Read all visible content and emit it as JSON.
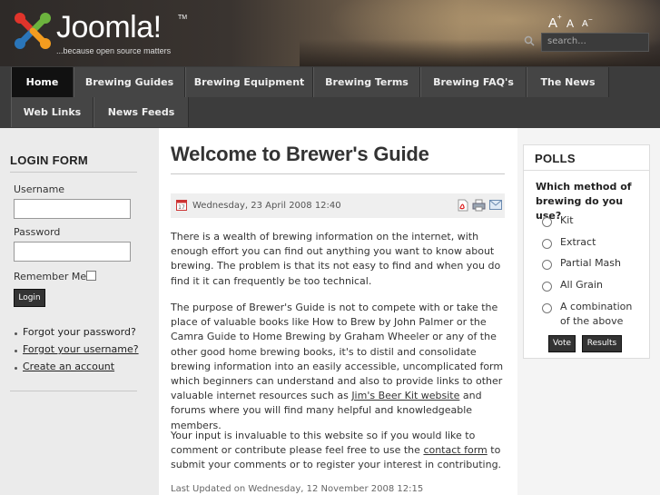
{
  "header": {
    "logo_text": "Joomla!",
    "logo_tm": "TM",
    "tagline": "...because open source matters",
    "font_size_controls": [
      "A",
      "A",
      "A"
    ],
    "search_placeholder": "search...",
    "colors": {
      "logo_red": "#e0342b",
      "logo_green": "#6cb33e",
      "logo_blue": "#2a75b9",
      "logo_orange": "#f39c1f"
    }
  },
  "nav": {
    "items": [
      {
        "label": "Home",
        "active": true
      },
      {
        "label": "Brewing Guides",
        "active": false
      },
      {
        "label": "Brewing Equipment",
        "active": false
      },
      {
        "label": "Brewing Terms",
        "active": false
      },
      {
        "label": "Brewing FAQ's",
        "active": false
      },
      {
        "label": "The News",
        "active": false
      },
      {
        "label": "Web Links",
        "active": false
      },
      {
        "label": "News Feeds",
        "active": false
      }
    ]
  },
  "login": {
    "title": "LOGIN FORM",
    "username_label": "Username",
    "password_label": "Password",
    "remember_label": "Remember Me",
    "submit_label": "Login",
    "links": [
      "Forgot your password?",
      "Forgot your username?",
      "Create an account"
    ]
  },
  "article": {
    "title": "Welcome to Brewer's Guide",
    "date": "Wednesday, 23 April 2008 12:40",
    "icons": [
      "calendar-icon",
      "pdf-icon",
      "print-icon",
      "email-icon"
    ],
    "p1": "There is a wealth of brewing information on the internet, with enough effort you can find out anything you want to know about brewing. The problem is that its not easy to find and when you do find it it can frequently be too technical.",
    "p2_before": "The purpose of Brewer's Guide is not to compete with or take the place of valuable books like How to Brew by John Palmer or the Camra Guide to Home Brewing by Graham Wheeler or any of the other good home brewing books, it's to distil and consolidate brewing information into an easily accessible, uncomplicated form which beginners can understand and also to provide links to other valuable internet resources such as",
    "p2_link": "Jim's Beer Kit website",
    "p2_after": "and forums where you will find many helpful and knowledgeable members.",
    "p3_before": "Your input is invaluable to this website so if you would like to comment or contribute please feel free to use the",
    "p3_link": "contact form",
    "p3_after": "to submit your comments or to register your interest in contributing.",
    "updated": "Last Updated on Wednesday, 12 November 2008 12:15"
  },
  "poll": {
    "title": "POLLS",
    "question": "Which method of brewing do you use?",
    "options": [
      "Kit",
      "Extract",
      "Partial Mash",
      "All Grain",
      "A combination of the above"
    ],
    "vote_label": "Vote",
    "results_label": "Results"
  }
}
